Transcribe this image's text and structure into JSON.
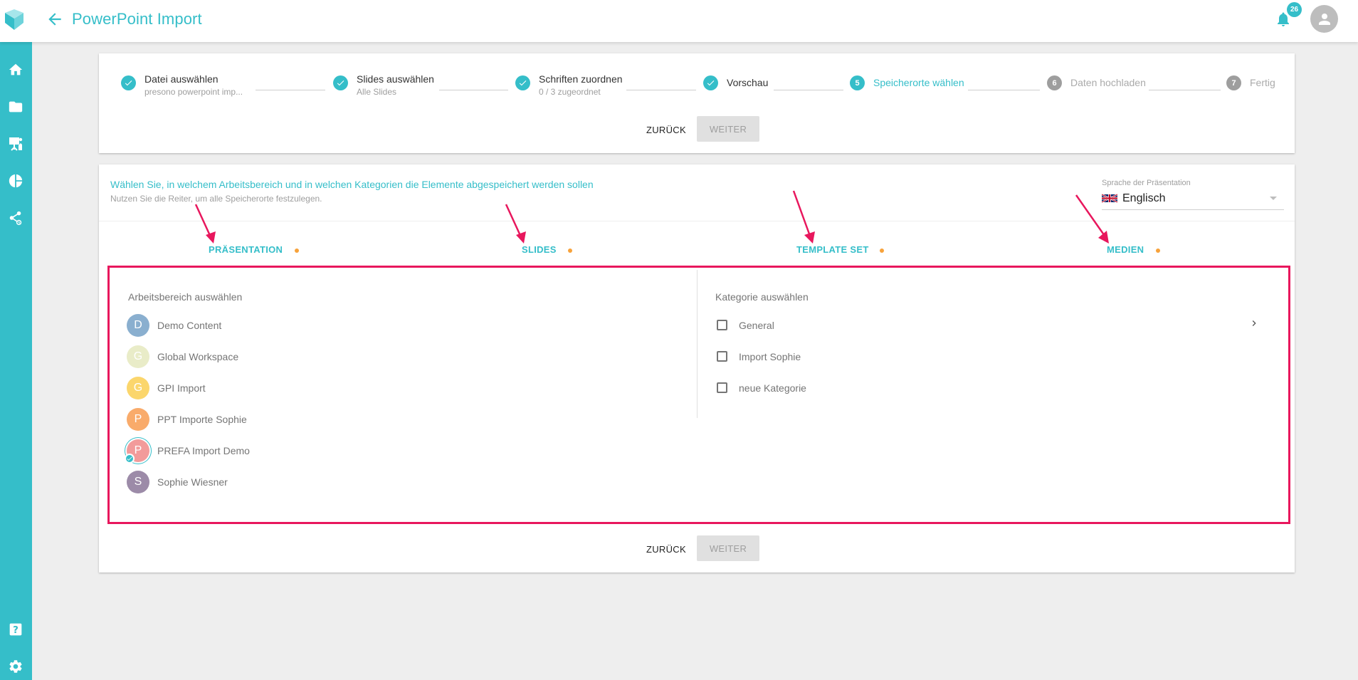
{
  "header": {
    "title": "PowerPoint Import",
    "notification_count": "26"
  },
  "stepper": {
    "steps": [
      {
        "number": "1",
        "title": "Datei auswählen",
        "subtitle": "presono powerpoint imp...",
        "state": "done"
      },
      {
        "number": "2",
        "title": "Slides auswählen",
        "subtitle": "Alle Slides",
        "state": "done"
      },
      {
        "number": "3",
        "title": "Schriften zuordnen",
        "subtitle": "0 / 3 zugeordnet",
        "state": "done"
      },
      {
        "number": "4",
        "title": "Vorschau",
        "subtitle": "",
        "state": "done"
      },
      {
        "number": "5",
        "title": "Speicherorte wählen",
        "subtitle": "",
        "state": "active"
      },
      {
        "number": "6",
        "title": "Daten hochladen",
        "subtitle": "",
        "state": "todo"
      },
      {
        "number": "7",
        "title": "Fertig",
        "subtitle": "",
        "state": "todo"
      }
    ],
    "back_label": "ZURÜCK",
    "next_label": "WEITER"
  },
  "main": {
    "instruction_title": "Wählen Sie, in welchem Arbeitsbereich und in welchen Kategorien die Elemente abgespeichert werden sollen",
    "instruction_sub": "Nutzen Sie die Reiter, um alle Speicherorte festzulegen.",
    "language_label": "Sprache der Präsentation",
    "language_value": "Englisch",
    "tabs": [
      {
        "label": "PRÄSENTATION"
      },
      {
        "label": "SLIDES"
      },
      {
        "label": "TEMPLATE SET"
      },
      {
        "label": "MEDIEN"
      }
    ],
    "workspace_label": "Arbeitsbereich auswählen",
    "workspaces": [
      {
        "initial": "D",
        "name": "Demo Content",
        "color": "#8aafcf",
        "selected": false
      },
      {
        "initial": "G",
        "name": "Global Workspace",
        "color": "#e9ecc8",
        "selected": false
      },
      {
        "initial": "G",
        "name": "GPI Import",
        "color": "#fbd66c",
        "selected": false
      },
      {
        "initial": "P",
        "name": "PPT Importe Sophie",
        "color": "#f9ab6b",
        "selected": false
      },
      {
        "initial": "P",
        "name": "PREFA Import Demo",
        "color": "#f29b9b",
        "selected": true
      },
      {
        "initial": "S",
        "name": "Sophie Wiesner",
        "color": "#9c8ba8",
        "selected": false
      }
    ],
    "category_label": "Kategorie auswählen",
    "categories": [
      {
        "name": "General",
        "checked": false
      },
      {
        "name": "Import Sophie",
        "checked": false
      },
      {
        "name": "neue Kategorie",
        "checked": false
      }
    ],
    "back_label": "ZURÜCK",
    "next_label": "WEITER"
  },
  "colors": {
    "accent": "#35bec9",
    "highlight": "#e8175d",
    "tab_dot": "#f7a23b"
  },
  "icons": {
    "sidebar": [
      "home-icon",
      "folder-icon",
      "presentation-icon",
      "pie-chart-icon",
      "share-icon",
      "help-icon",
      "settings-icon"
    ]
  }
}
